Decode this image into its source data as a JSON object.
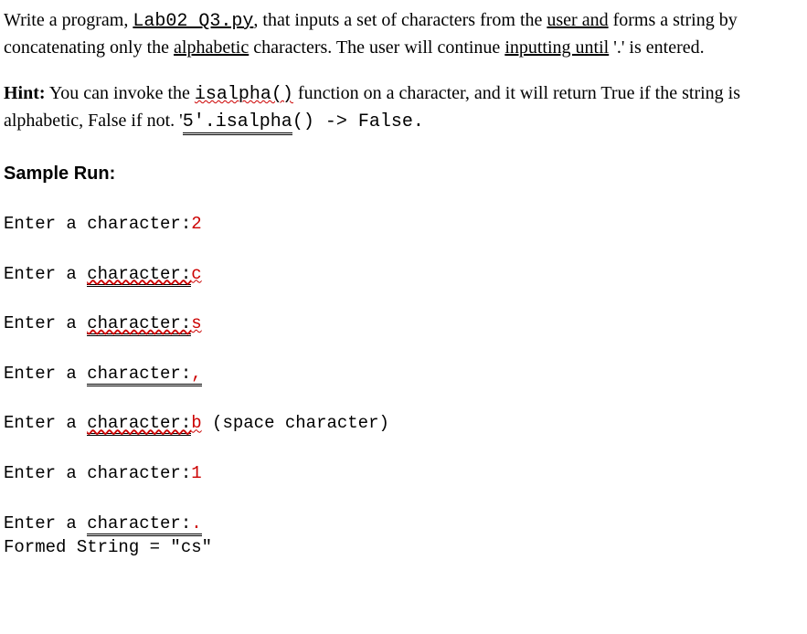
{
  "para1": {
    "t1": "Write a program, ",
    "filename": "Lab02_Q3.py",
    "t2": ", that inputs a set of characters from the ",
    "t3": "user  and",
    "t4": " forms a string by concatenating only the ",
    "t5": "alphabetic",
    "t6": " characters. The user will continue ",
    "t7": "inputting  until",
    "t8": " '.' is entered."
  },
  "para2": {
    "hint": "Hint:",
    "t1": "  You can invoke the ",
    "func": "isalpha()",
    "t2": " function on a character, and it will return True if the string is alphabetic, False if not.  '",
    "code": "5'.isalpha",
    "t3": "() -> False."
  },
  "sampleHeading": "Sample Run:",
  "prompt": "Enter a character:",
  "inputs": {
    "l1": "2",
    "l2": "c",
    "l3": "s",
    "l4": ",",
    "l5": "b",
    "l5note": " (space character)",
    "l6": "1",
    "l7": "."
  },
  "charWord": "character:",
  "formed": "Formed String = \"cs\""
}
